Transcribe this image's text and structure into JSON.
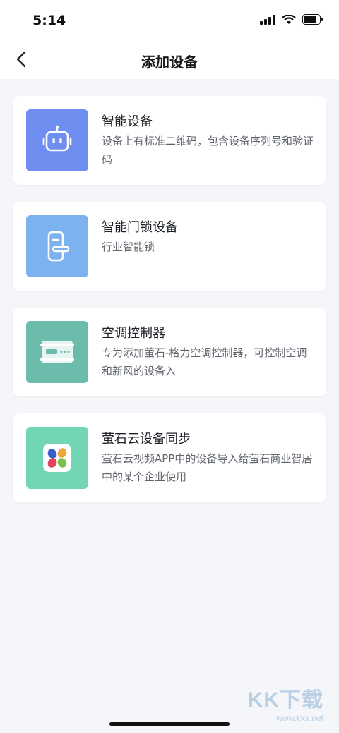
{
  "status": {
    "time": "5:14"
  },
  "header": {
    "title": "添加设备"
  },
  "items": [
    {
      "title": "智能设备",
      "desc": "设备上有标准二维码，包含设备序列号和验证码",
      "icon": "robot-icon",
      "color": "#6f8ff0"
    },
    {
      "title": "智能门锁设备",
      "desc": "行业智能锁",
      "icon": "door-lock-icon",
      "color": "#7db2f0"
    },
    {
      "title": "空调控制器",
      "desc": "专为添加萤石-格力空调控制器，可控制空调和新风的设备入",
      "icon": "ac-controller-icon",
      "color": "#6cbcae"
    },
    {
      "title": "萤石云设备同步",
      "desc": "萤石云视频APP中的设备导入给萤石商业智居中的某个企业使用",
      "icon": "ezviz-app-icon",
      "color": "#72d5b3"
    }
  ],
  "watermark": {
    "logo": "KK下载",
    "url": "www.kkx.net"
  }
}
